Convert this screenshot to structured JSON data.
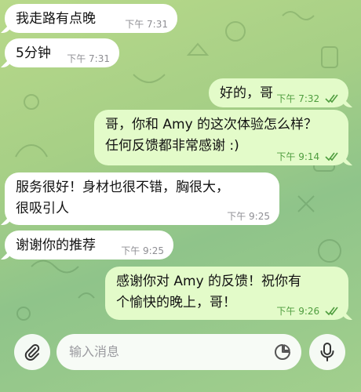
{
  "messages": [
    {
      "side": "in",
      "lines": [
        "我走路有点晚"
      ],
      "time": "下午 7:31"
    },
    {
      "side": "in",
      "lines": [
        "5分钟"
      ],
      "time": "下午 7:31"
    },
    {
      "side": "out",
      "lines": [
        "好的，哥"
      ],
      "time": "下午 7:32",
      "read": true
    },
    {
      "side": "out",
      "lines": [
        "哥，你和 Amy 的这次体验怎么样？",
        "任何反馈都非常感谢 :)"
      ],
      "time": "下午 9:14",
      "read": true
    },
    {
      "side": "in",
      "lines": [
        "服务很好！身材也很不错，胸很大，",
        "很吸引人"
      ],
      "time": "下午 9:25"
    },
    {
      "side": "in",
      "lines": [
        "谢谢你的推荐"
      ],
      "time": "下午 9:25"
    },
    {
      "side": "out",
      "lines": [
        "感谢你对 Amy 的反馈！祝你有",
        "个愉快的晚上，哥！"
      ],
      "time": "下午 9:26",
      "read": true
    }
  ],
  "composer": {
    "placeholder": "输入消息",
    "attach_icon": "paperclip-icon",
    "sticker_icon": "sticker-icon",
    "mic_icon": "microphone-icon"
  },
  "colors": {
    "incoming_bubble": "#ffffff",
    "outgoing_bubble": "#e3fbc9",
    "outgoing_meta": "#4f9d3f",
    "incoming_meta": "#8e8e93"
  }
}
